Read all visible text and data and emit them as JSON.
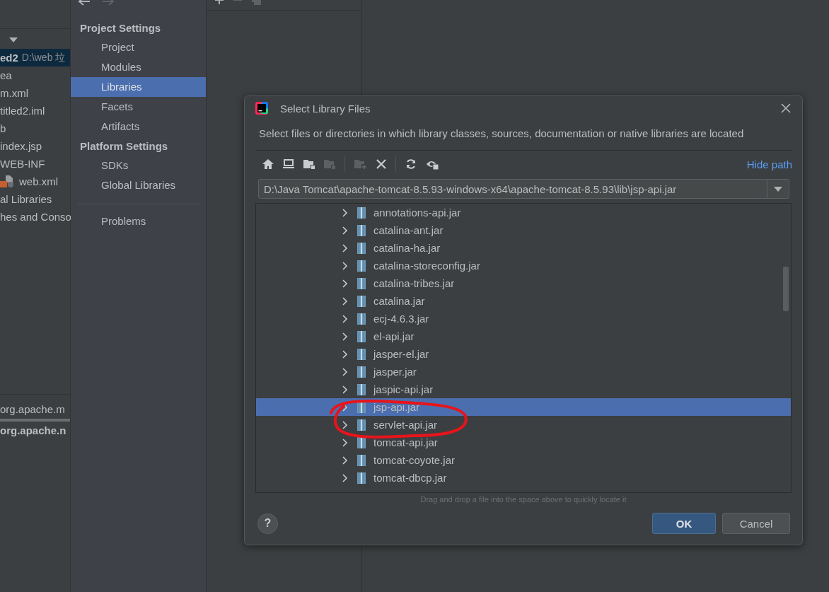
{
  "project_panel": {
    "items": [
      {
        "label": "ed2",
        "detail": "D:\\web 垃",
        "kind": "module",
        "selected": true
      },
      {
        "label": "ea",
        "kind": "plain",
        "selected": false
      },
      {
        "label": "m.xml",
        "kind": "plain",
        "selected": false
      },
      {
        "label": "titled2.iml",
        "kind": "plain",
        "selected": false
      },
      {
        "label": "b",
        "kind": "plain",
        "selected": false
      },
      {
        "label": "index.jsp",
        "kind": "plain",
        "selected": false
      },
      {
        "label": "WEB-INF",
        "kind": "plain",
        "selected": false
      },
      {
        "label": "web.xml",
        "kind": "xml",
        "selected": false
      },
      {
        "label": "al Libraries",
        "kind": "plain",
        "selected": false
      },
      {
        "label": "hes and Conso",
        "kind": "plain",
        "selected": false
      }
    ],
    "bottom_lines": [
      {
        "label": "org.apache.m",
        "bold": false
      },
      {
        "label": "org.apache.n",
        "bold": true
      }
    ]
  },
  "settings_sidebar": {
    "groups": [
      {
        "title": "Project Settings",
        "items": [
          {
            "label": "Project",
            "selected": false
          },
          {
            "label": "Modules",
            "selected": false
          },
          {
            "label": "Libraries",
            "selected": true
          },
          {
            "label": "Facets",
            "selected": false
          },
          {
            "label": "Artifacts",
            "selected": false
          }
        ]
      },
      {
        "title": "Platform Settings",
        "items": [
          {
            "label": "SDKs",
            "selected": false
          },
          {
            "label": "Global Libraries",
            "selected": false
          }
        ]
      }
    ],
    "extra_items": [
      {
        "label": "Problems",
        "selected": false
      }
    ]
  },
  "dialog": {
    "title": "Select Library Files",
    "description": "Select files or directories in which library classes, sources, documentation or native libraries are located",
    "hide_path_link": "Hide path",
    "path": "D:\\Java Tomcat\\apache-tomcat-8.5.93-windows-x64\\apache-tomcat-8.5.93\\lib\\jsp-api.jar",
    "files": [
      {
        "name": "annotations-api.jar",
        "selected": false
      },
      {
        "name": "catalina-ant.jar",
        "selected": false
      },
      {
        "name": "catalina-ha.jar",
        "selected": false
      },
      {
        "name": "catalina-storeconfig.jar",
        "selected": false
      },
      {
        "name": "catalina-tribes.jar",
        "selected": false
      },
      {
        "name": "catalina.jar",
        "selected": false
      },
      {
        "name": "ecj-4.6.3.jar",
        "selected": false
      },
      {
        "name": "el-api.jar",
        "selected": false
      },
      {
        "name": "jasper-el.jar",
        "selected": false
      },
      {
        "name": "jasper.jar",
        "selected": false
      },
      {
        "name": "jaspic-api.jar",
        "selected": false
      },
      {
        "name": "jsp-api.jar",
        "selected": true
      },
      {
        "name": "servlet-api.jar",
        "selected": false
      },
      {
        "name": "tomcat-api.jar",
        "selected": false
      },
      {
        "name": "tomcat-coyote.jar",
        "selected": false
      },
      {
        "name": "tomcat-dbcp.jar",
        "selected": false
      }
    ],
    "hint": "Drag and drop a file into the space above to quickly locate it",
    "help_button": "?",
    "buttons": [
      {
        "label": "OK",
        "kind": "default"
      },
      {
        "label": "Cancel",
        "kind": "normal"
      }
    ]
  }
}
